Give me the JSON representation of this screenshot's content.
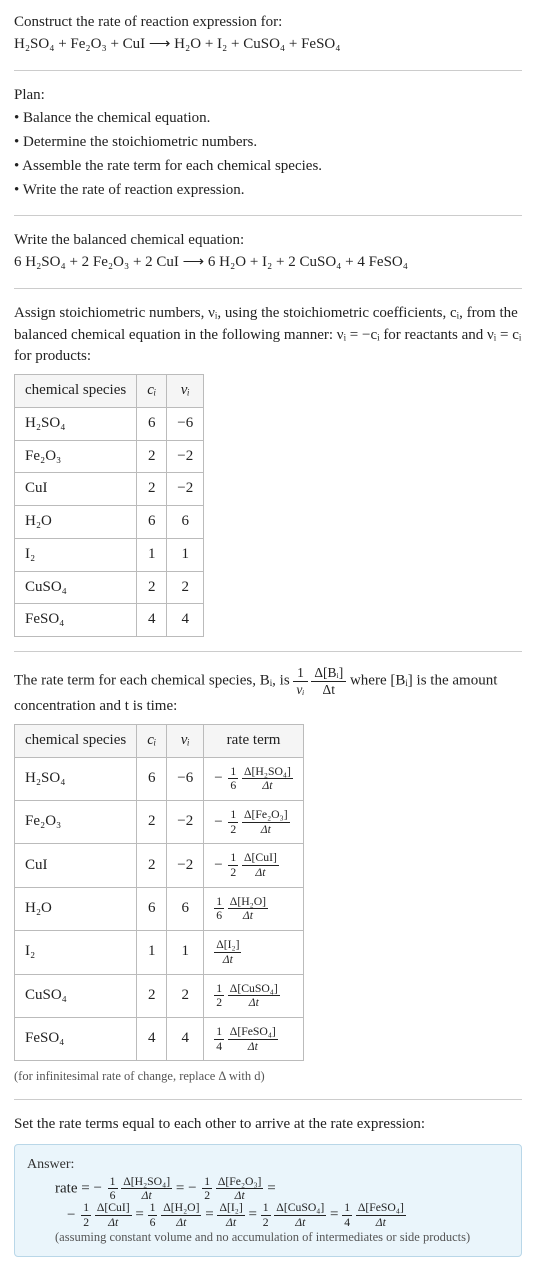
{
  "intro": {
    "title": "Construct the rate of reaction expression for:",
    "equation": "H₂SO₄ + Fe₂O₃ + CuI ⟶ H₂O + I₂ + CuSO₄ + FeSO₄"
  },
  "plan": {
    "label": "Plan:",
    "items": [
      "• Balance the chemical equation.",
      "• Determine the stoichiometric numbers.",
      "• Assemble the rate term for each chemical species.",
      "• Write the rate of reaction expression."
    ]
  },
  "balanced": {
    "label": "Write the balanced chemical equation:",
    "equation": "6 H₂SO₄ + 2 Fe₂O₃ + 2 CuI ⟶ 6 H₂O + I₂ + 2 CuSO₄ + 4 FeSO₄"
  },
  "assign": {
    "text": "Assign stoichiometric numbers, νᵢ, using the stoichiometric coefficients, cᵢ, from the balanced chemical equation in the following manner: νᵢ = −cᵢ for reactants and νᵢ = cᵢ for products:"
  },
  "table1": {
    "headers": [
      "chemical species",
      "cᵢ",
      "νᵢ"
    ],
    "rows": [
      [
        "H₂SO₄",
        "6",
        "−6"
      ],
      [
        "Fe₂O₃",
        "2",
        "−2"
      ],
      [
        "CuI",
        "2",
        "−2"
      ],
      [
        "H₂O",
        "6",
        "6"
      ],
      [
        "I₂",
        "1",
        "1"
      ],
      [
        "CuSO₄",
        "2",
        "2"
      ],
      [
        "FeSO₄",
        "4",
        "4"
      ]
    ]
  },
  "rateterm": {
    "pre": "The rate term for each chemical species, Bᵢ, is ",
    "post": " where [Bᵢ] is the amount concentration and t is time:",
    "frac_coef_n": "1",
    "frac_coef_d": "νᵢ",
    "frac_dB_n": "Δ[Bᵢ]",
    "frac_dB_d": "Δt"
  },
  "table2": {
    "headers": [
      "chemical species",
      "cᵢ",
      "νᵢ",
      "rate term"
    ],
    "rows": [
      {
        "sp": "H₂SO₄",
        "c": "6",
        "v": "−6",
        "sign": "−",
        "cn": "1",
        "cd": "6",
        "dn": "Δ[H₂SO₄]",
        "dd": "Δt"
      },
      {
        "sp": "Fe₂O₃",
        "c": "2",
        "v": "−2",
        "sign": "−",
        "cn": "1",
        "cd": "2",
        "dn": "Δ[Fe₂O₃]",
        "dd": "Δt"
      },
      {
        "sp": "CuI",
        "c": "2",
        "v": "−2",
        "sign": "−",
        "cn": "1",
        "cd": "2",
        "dn": "Δ[CuI]",
        "dd": "Δt"
      },
      {
        "sp": "H₂O",
        "c": "6",
        "v": "6",
        "sign": "",
        "cn": "1",
        "cd": "6",
        "dn": "Δ[H₂O]",
        "dd": "Δt"
      },
      {
        "sp": "I₂",
        "c": "1",
        "v": "1",
        "sign": "",
        "cn": "",
        "cd": "",
        "dn": "Δ[I₂]",
        "dd": "Δt"
      },
      {
        "sp": "CuSO₄",
        "c": "2",
        "v": "2",
        "sign": "",
        "cn": "1",
        "cd": "2",
        "dn": "Δ[CuSO₄]",
        "dd": "Δt"
      },
      {
        "sp": "FeSO₄",
        "c": "4",
        "v": "4",
        "sign": "",
        "cn": "1",
        "cd": "4",
        "dn": "Δ[FeSO₄]",
        "dd": "Δt"
      }
    ]
  },
  "infinitesimal": "(for infinitesimal rate of change, replace Δ with d)",
  "setrate": "Set the rate terms equal to each other to arrive at the rate expression:",
  "answer": {
    "label": "Answer:",
    "rate_label": "rate = ",
    "terms": [
      {
        "sign": "−",
        "cn": "1",
        "cd": "6",
        "dn": "Δ[H₂SO₄]",
        "dd": "Δt"
      },
      {
        "sign": "−",
        "cn": "1",
        "cd": "2",
        "dn": "Δ[Fe₂O₃]",
        "dd": "Δt"
      },
      {
        "sign": "−",
        "cn": "1",
        "cd": "2",
        "dn": "Δ[CuI]",
        "dd": "Δt"
      },
      {
        "sign": "",
        "cn": "1",
        "cd": "6",
        "dn": "Δ[H₂O]",
        "dd": "Δt"
      },
      {
        "sign": "",
        "cn": "",
        "cd": "",
        "dn": "Δ[I₂]",
        "dd": "Δt"
      },
      {
        "sign": "",
        "cn": "1",
        "cd": "2",
        "dn": "Δ[CuSO₄]",
        "dd": "Δt"
      },
      {
        "sign": "",
        "cn": "1",
        "cd": "4",
        "dn": "Δ[FeSO₄]",
        "dd": "Δt"
      }
    ],
    "note": "(assuming constant volume and no accumulation of intermediates or side products)"
  }
}
